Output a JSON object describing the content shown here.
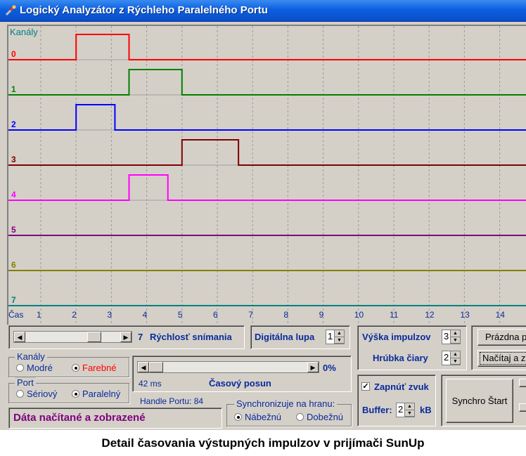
{
  "window": {
    "title": "Logický Analyzátor z Rýchleho Paralelného Portu"
  },
  "plot": {
    "channels_label": "Kanály",
    "time_label": "Čas",
    "time_ticks": [
      "1",
      "2",
      "3",
      "4",
      "5",
      "6",
      "7",
      "8",
      "9",
      "10",
      "11",
      "12",
      "13",
      "14"
    ],
    "channels": [
      {
        "id": "0",
        "color": "#ff0000",
        "pulse": [
          2.0,
          3.5
        ]
      },
      {
        "id": "1",
        "color": "#008000",
        "pulse": [
          3.5,
          5.0
        ]
      },
      {
        "id": "2",
        "color": "#0000ff",
        "pulse": [
          2.0,
          3.1
        ]
      },
      {
        "id": "3",
        "color": "#800000",
        "pulse": [
          5.0,
          6.6
        ]
      },
      {
        "id": "4",
        "color": "#ff00ff",
        "pulse": [
          3.5,
          4.6
        ]
      },
      {
        "id": "5",
        "color": "#800080",
        "pulse": null
      },
      {
        "id": "6",
        "color": "#808000",
        "pulse": null
      },
      {
        "id": "7",
        "color": "#008080",
        "pulse": null
      }
    ]
  },
  "speed": {
    "value": "7",
    "label": "Rýchlosť snímania",
    "slider_fraction": 0.75
  },
  "zoom": {
    "label": "Digitálna lupa",
    "value": "1"
  },
  "pulse_height": {
    "label": "Výška impulzov",
    "value": "3"
  },
  "line_width": {
    "label": "Hrúbka čiary",
    "value": "2"
  },
  "buttons": {
    "empty": "Prázdna p",
    "load": "Načítaj a z",
    "synchro": "Synchro Štart"
  },
  "channels_group": {
    "title": "Kanály",
    "opt1": "Modré",
    "opt2": "Farebné",
    "selected": 2
  },
  "port_group": {
    "title": "Port",
    "opt1": "Sériový",
    "opt2": "Paralelný",
    "selected": 2
  },
  "time_shift": {
    "percent": "0%",
    "ms": "42 ms",
    "label": "Časový posun"
  },
  "handle": {
    "text": "Handle Portu: 84"
  },
  "sync_group": {
    "title": "Synchronizuje na hranu:",
    "opt1": "Nábežnú",
    "opt2": "Dobežnú",
    "selected": 1
  },
  "status": {
    "text": "Dáta načítané a zobrazené"
  },
  "sound": {
    "label": "Zapnúť zvuk",
    "checked": true
  },
  "buffer": {
    "label": "Buffer:",
    "value": "2",
    "unit": "kB"
  },
  "caption": "Detail časovania výstupných impulzov v prijímači SunUp"
}
